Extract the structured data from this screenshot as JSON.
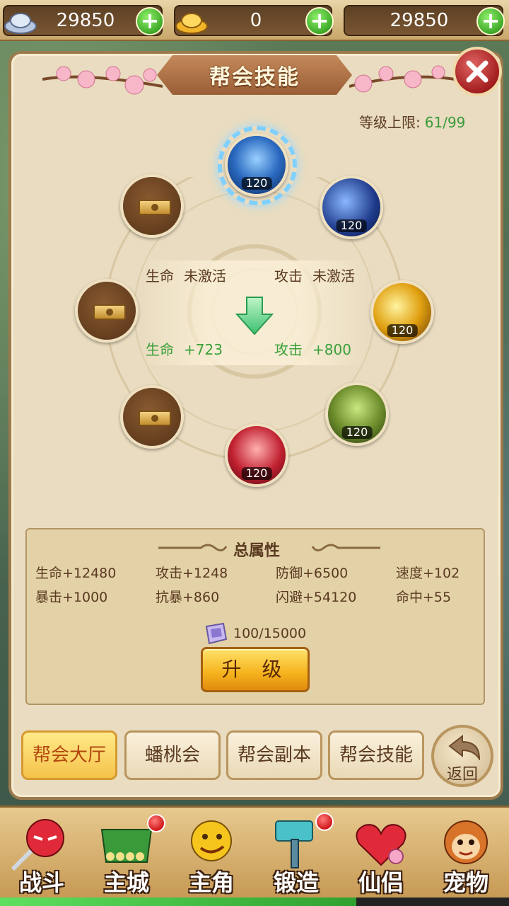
{
  "currency": {
    "silver": "29850",
    "gold": "0",
    "third": "29850"
  },
  "panel": {
    "title": "帮会技能",
    "level_cap_label": "等级上限:",
    "level_cap_value": "61/99"
  },
  "skills": {
    "nodes": [
      {
        "name": "skill-top",
        "level": "120",
        "color": "#2a6ac0"
      },
      {
        "name": "skill-upper-right",
        "level": "120",
        "color": "#1e3a8a"
      },
      {
        "name": "skill-right",
        "level": "120",
        "color": "#e0a010"
      },
      {
        "name": "skill-lower-right",
        "level": "120",
        "color": "#6a8a2a"
      },
      {
        "name": "skill-bottom",
        "level": "120",
        "color": "#c02030"
      }
    ],
    "mid": {
      "hp_label": "生命",
      "hp_status": "未激活",
      "atk_label": "攻击",
      "atk_status": "未激活",
      "hp_next_label": "生命",
      "hp_next_value": "+723",
      "atk_next_label": "攻击",
      "atk_next_value": "+800"
    }
  },
  "attributes": {
    "title": "总属性",
    "row1": [
      "生命+12480",
      "攻击+1248",
      "防御+6500",
      "速度+102"
    ],
    "row2": [
      "暴击+1000",
      "抗暴+860",
      "闪避+54120",
      "命中+55"
    ],
    "cost": "100/15000",
    "upgrade_label": "升 级"
  },
  "tabs": [
    "帮会大厅",
    "蟠桃会",
    "帮会副本",
    "帮会技能"
  ],
  "back_label": "返回",
  "nav": [
    "战斗",
    "主城",
    "主角",
    "锻造",
    "仙侣",
    "宠物"
  ],
  "progress": 0.7
}
